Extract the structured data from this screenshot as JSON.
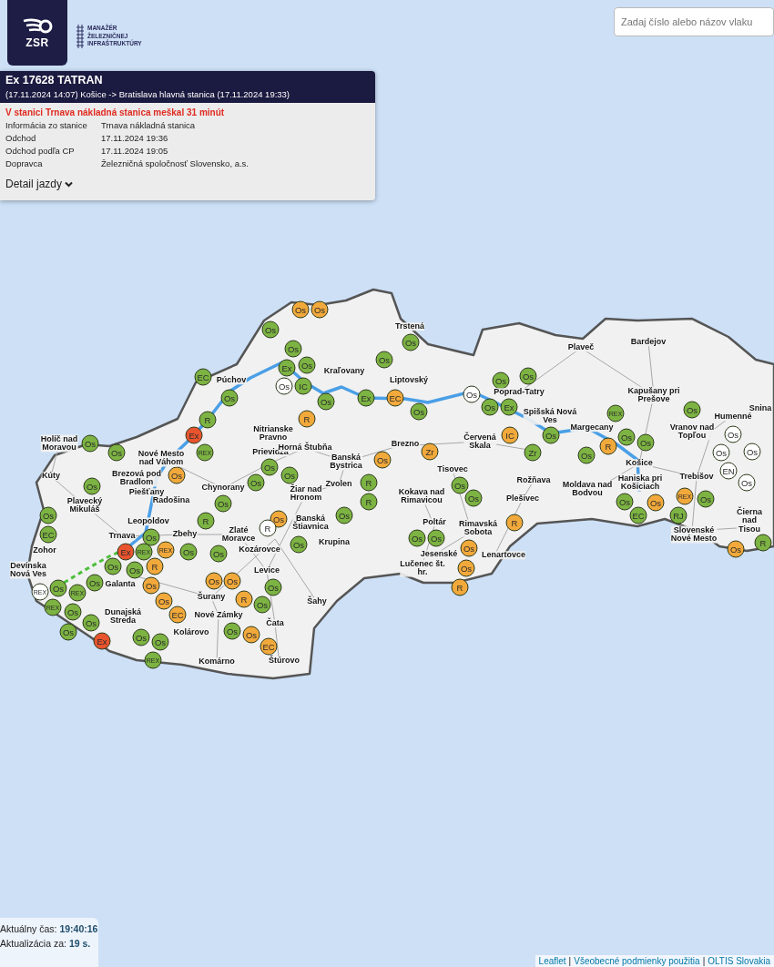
{
  "logo": {
    "mark": "ZSR",
    "caption": "MANAŽÉR\nŽELEZNIČNEJ\nINFRAŠTRUKTÚRY"
  },
  "search": {
    "placeholder": "Zadaj číslo alebo názov vlaku"
  },
  "train_panel": {
    "title": "Ex 17628 TATRAN",
    "route": "(17.11.2024 14:07) Košice -> Bratislava hlavná stanica (17.11.2024 19:33)",
    "delay": "V stanici Trnava nákladná stanica meškal 31 minút",
    "details": [
      {
        "label": "Informácia zo stanice",
        "value": "Trnava nákladná stanica"
      },
      {
        "label": "Odchod",
        "value": "17.11.2024 19:36"
      },
      {
        "label": "Odchod podľa CP",
        "value": "17.11.2024 19:05"
      },
      {
        "label": "Dopravca",
        "value": "Železničná spoločnosť Slovensko, a.s."
      }
    ],
    "toggle": "Detail jazdy",
    "expanded": false
  },
  "map": {
    "places": [
      "Trstená",
      "Plaveč",
      "Bardejov",
      "Púchov",
      "Kraľovany",
      "Liptovský",
      "Poprad-Tatry",
      "Kapušany pri\nPrešove",
      "Spišská Nová\nVes",
      "Humenné",
      "Snina",
      "Nitrianske\nPravno",
      "Margecany",
      "Vranov nad\nTopľou",
      "Holíč nad\nMoravou",
      "Prievidza",
      "Horná Štubňa",
      "Brezno",
      "Červená\nSkala",
      "Nové Mesto\nnad Váhom",
      "Banská\nBystrica",
      "Košice",
      "Kúty",
      "Brezová pod\nBradlom",
      "Tisovec",
      "Rožňava",
      "Haniska pri\nKošiciach",
      "Trebišov",
      "Piešťany",
      "Chynorany",
      "Žiar nad\nHronom",
      "Zvolen",
      "Moldava nad\nBodvou",
      "Plavecký\nMikuláš",
      "Radošina",
      "Kokava nad\nRimavicou",
      "Plešivec",
      "Leopoldov",
      "Banská\nŠtiavnica",
      "Poltár",
      "Rimavská\nSobota",
      "Čierna nad\nTisou",
      "Trnava",
      "Zbehy",
      "Zlaté\nMoravce",
      "Slovenské\nNové Mesto",
      "Zohor",
      "Kozárovce",
      "Krupina",
      "Jesenské",
      "Lenartovce",
      "Devínska\nNová Ves",
      "Levice",
      "Lučenec št.\nhr.",
      "Galanta",
      "Šurany",
      "Šahy",
      "Dunajská\nStreda",
      "Nové Zámky",
      "Čata",
      "Kolárovo",
      "Komárno",
      "Štúrovo"
    ],
    "trains": [
      {
        "label": "Os",
        "color": "#f2a93b"
      },
      {
        "label": "Os",
        "color": "#f2a93b"
      },
      {
        "label": "Os",
        "color": "#7cb342"
      },
      {
        "label": "Os",
        "color": "#7cb342"
      },
      {
        "label": "Os",
        "color": "#7cb342"
      },
      {
        "label": "Ex",
        "color": "#7cb342"
      },
      {
        "label": "Os",
        "color": "#7cb342"
      },
      {
        "label": "Os",
        "color": "#7cb342"
      },
      {
        "label": "EC",
        "color": "#7cb342"
      },
      {
        "label": "Os",
        "color": "#7cb342"
      },
      {
        "label": "Os",
        "color": "#7cb342"
      },
      {
        "label": "Os",
        "color": "#ffffff"
      },
      {
        "label": "IC",
        "color": "#7cb342"
      },
      {
        "label": "Os",
        "color": "#7cb342"
      },
      {
        "label": "Os",
        "color": "#7cb342"
      },
      {
        "label": "Ex",
        "color": "#7cb342"
      },
      {
        "label": "EC",
        "color": "#f2a93b"
      },
      {
        "label": "Os",
        "color": "#ffffff"
      },
      {
        "label": "Os",
        "color": "#7cb342"
      },
      {
        "label": "Os",
        "color": "#7cb342"
      },
      {
        "label": "Ex",
        "color": "#7cb342"
      },
      {
        "label": "REX",
        "color": "#7cb342"
      },
      {
        "label": "Os",
        "color": "#7cb342"
      },
      {
        "label": "R",
        "color": "#7cb342"
      },
      {
        "label": "R",
        "color": "#f2a93b"
      },
      {
        "label": "Ex",
        "color": "#e8542e"
      },
      {
        "label": "IC",
        "color": "#f2a93b"
      },
      {
        "label": "Os",
        "color": "#7cb342"
      },
      {
        "label": "Os",
        "color": "#7cb342"
      },
      {
        "label": "Os",
        "color": "#ffffff"
      },
      {
        "label": "Os",
        "color": "#7cb342"
      },
      {
        "label": "R",
        "color": "#f2a93b"
      },
      {
        "label": "Os",
        "color": "#7cb342"
      },
      {
        "label": "Os",
        "color": "#7cb342"
      },
      {
        "label": "REX",
        "color": "#7cb342"
      },
      {
        "label": "Zr",
        "color": "#f2a93b"
      },
      {
        "label": "Zr",
        "color": "#7cb342"
      },
      {
        "label": "Os",
        "color": "#7cb342"
      },
      {
        "label": "Os",
        "color": "#ffffff"
      },
      {
        "label": "Os",
        "color": "#ffffff"
      },
      {
        "label": "Os",
        "color": "#f2a93b"
      },
      {
        "label": "Os",
        "color": "#7cb342"
      },
      {
        "label": "EN",
        "color": "#ffffff"
      },
      {
        "label": "Os",
        "color": "#f2a93b"
      },
      {
        "label": "Os",
        "color": "#7cb342"
      },
      {
        "label": "R",
        "color": "#7cb342"
      },
      {
        "label": "Os",
        "color": "#7cb342"
      },
      {
        "label": "Os",
        "color": "#7cb342"
      },
      {
        "label": "Os",
        "color": "#7cb342"
      },
      {
        "label": "Os",
        "color": "#ffffff"
      },
      {
        "label": "Os",
        "color": "#7cb342"
      },
      {
        "label": "R",
        "color": "#7cb342"
      },
      {
        "label": "Os",
        "color": "#7cb342"
      },
      {
        "label": "Os",
        "color": "#7cb342"
      },
      {
        "label": "Os",
        "color": "#f2a93b"
      },
      {
        "label": "REX",
        "color": "#f2a93b"
      },
      {
        "label": "Os",
        "color": "#7cb342"
      },
      {
        "label": "Os",
        "color": "#7cb342"
      },
      {
        "label": "R",
        "color": "#7cb342"
      },
      {
        "label": "Os",
        "color": "#f2a93b"
      },
      {
        "label": "Os",
        "color": "#7cb342"
      },
      {
        "label": "R",
        "color": "#f2a93b"
      },
      {
        "label": "EC",
        "color": "#7cb342"
      },
      {
        "label": "RJ",
        "color": "#7cb342"
      },
      {
        "label": "R",
        "color": "#ffffff"
      },
      {
        "label": "EC",
        "color": "#7cb342"
      },
      {
        "label": "Os",
        "color": "#7cb342"
      },
      {
        "label": "Os",
        "color": "#7cb342"
      },
      {
        "label": "Os",
        "color": "#7cb342"
      },
      {
        "label": "Ex",
        "color": "#e8542e"
      },
      {
        "label": "REX",
        "color": "#7cb342"
      },
      {
        "label": "REX",
        "color": "#f2a93b"
      },
      {
        "label": "Os",
        "color": "#7cb342"
      },
      {
        "label": "Os",
        "color": "#7cb342"
      },
      {
        "label": "Os",
        "color": "#7cb342"
      },
      {
        "label": "Os",
        "color": "#f2a93b"
      },
      {
        "label": "Os",
        "color": "#f2a93b"
      },
      {
        "label": "R",
        "color": "#7cb342"
      },
      {
        "label": "Os",
        "color": "#7cb342"
      },
      {
        "label": "Os",
        "color": "#7cb342"
      },
      {
        "label": "R",
        "color": "#f2a93b"
      },
      {
        "label": "Os",
        "color": "#f2a93b"
      },
      {
        "label": "REX",
        "color": "#ffffff"
      },
      {
        "label": "Os",
        "color": "#7cb342"
      },
      {
        "label": "REX",
        "color": "#7cb342"
      },
      {
        "label": "Os",
        "color": "#7cb342"
      },
      {
        "label": "Os",
        "color": "#f2a93b"
      },
      {
        "label": "Os",
        "color": "#f2a93b"
      },
      {
        "label": "Os",
        "color": "#f2a93b"
      },
      {
        "label": "Os",
        "color": "#7cb342"
      },
      {
        "label": "R",
        "color": "#f2a93b"
      },
      {
        "label": "Os",
        "color": "#f2a93b"
      },
      {
        "label": "R",
        "color": "#f2a93b"
      },
      {
        "label": "Os",
        "color": "#7cb342"
      },
      {
        "label": "REX",
        "color": "#7cb342"
      },
      {
        "label": "Os",
        "color": "#7cb342"
      },
      {
        "label": "EC",
        "color": "#f2a93b"
      },
      {
        "label": "Os",
        "color": "#7cb342"
      },
      {
        "label": "Os",
        "color": "#7cb342"
      },
      {
        "label": "Os",
        "color": "#7cb342"
      },
      {
        "label": "Os",
        "color": "#f2a93b"
      },
      {
        "label": "Ex",
        "color": "#e8542e"
      },
      {
        "label": "Os",
        "color": "#7cb342"
      },
      {
        "label": "Os",
        "color": "#7cb342"
      },
      {
        "label": "EC",
        "color": "#f2a93b"
      },
      {
        "label": "REX",
        "color": "#7cb342"
      }
    ]
  },
  "clock": {
    "time_label": "Aktuálny čas:",
    "time": "19:40:16",
    "refresh_label": "Aktualizácia za:",
    "refresh": "19 s."
  },
  "attribution": {
    "links": [
      "Leaflet",
      "Všeobecné podmienky použitia",
      "OLTIS Slovakia"
    ],
    "separator": "|"
  }
}
